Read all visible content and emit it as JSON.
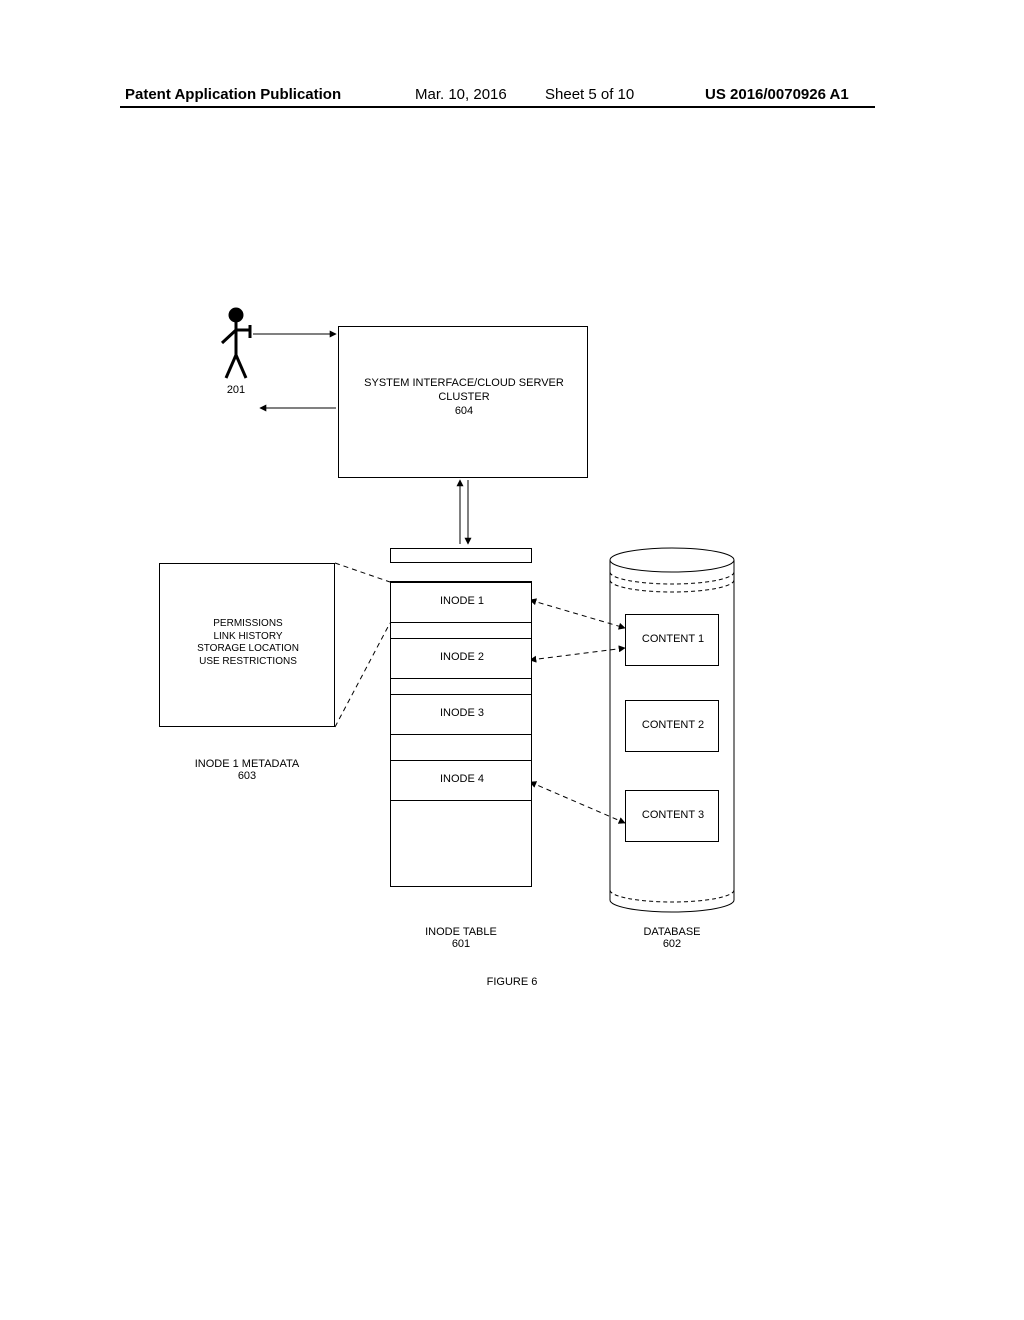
{
  "header": {
    "publication": "Patent Application Publication",
    "date": "Mar. 10, 2016",
    "sheet": "Sheet 5 of 10",
    "number": "US 2016/0070926 A1"
  },
  "user": {
    "ref": "201"
  },
  "system_box": {
    "line1": "SYSTEM INTERFACE/CLOUD SERVER",
    "line2": "CLUSTER",
    "ref": "604"
  },
  "metadata_box": {
    "line1": "PERMISSIONS",
    "line2": "LINK HISTORY",
    "line3": "STORAGE LOCATION",
    "line4": "USE RESTRICTIONS",
    "caption_line1": "INODE 1 METADATA",
    "caption_line2": "603"
  },
  "inode_table": {
    "rows": {
      "r1": "INODE 1",
      "r2": "INODE 2",
      "r3": "INODE 3",
      "r4": "INODE 4"
    },
    "caption_line1": "INODE TABLE",
    "caption_ref": "601"
  },
  "database": {
    "content1": "CONTENT 1",
    "content2": "CONTENT 2",
    "content3": "CONTENT 3",
    "caption_line1": "DATABASE",
    "caption_ref": "602"
  },
  "figure_caption": "FIGURE 6"
}
